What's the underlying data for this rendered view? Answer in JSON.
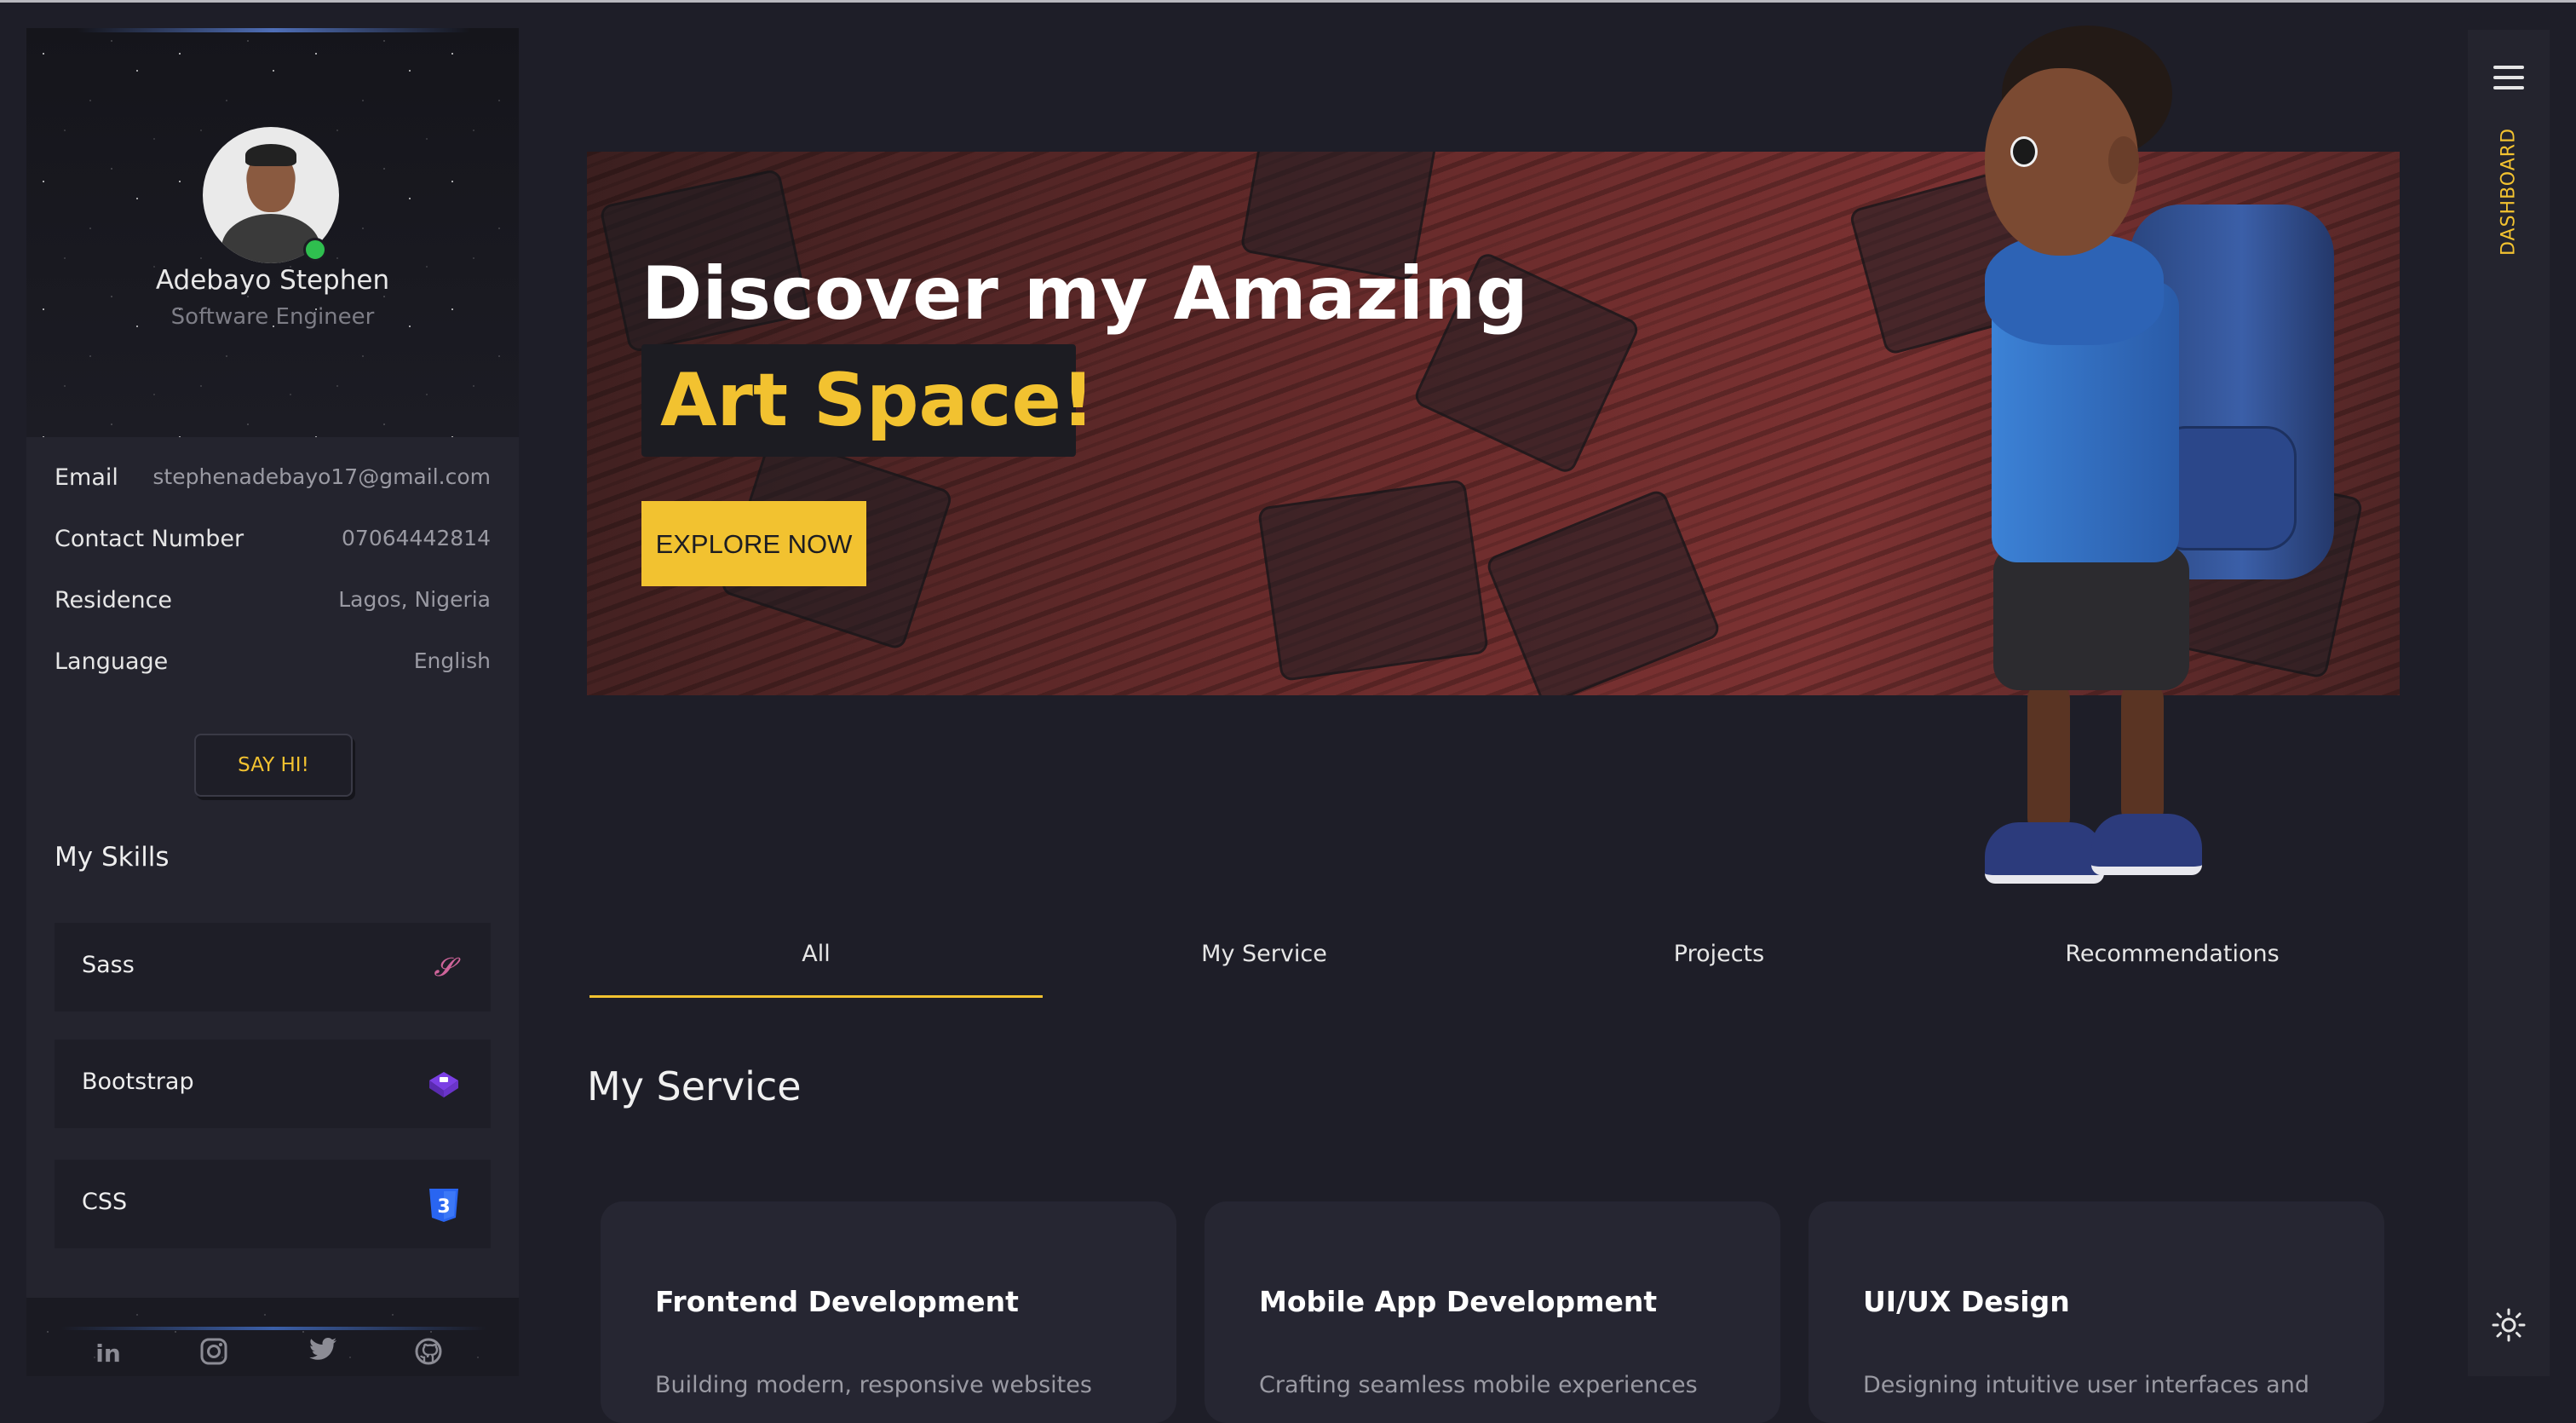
{
  "profile": {
    "name": "Adebayo Stephen",
    "role": "Software Engineer"
  },
  "info": [
    {
      "label": "Email",
      "value": "stephenadebayo17@gmail.com"
    },
    {
      "label": "Contact Number",
      "value": "07064442814"
    },
    {
      "label": "Residence",
      "value": "Lagos, Nigeria"
    },
    {
      "label": "Language",
      "value": "English"
    }
  ],
  "say_hi_label": "SAY HI!",
  "skills": {
    "title": "My Skills",
    "items": [
      {
        "label": "Sass",
        "icon": "sass-icon"
      },
      {
        "label": "Bootstrap",
        "icon": "bootstrap-icon"
      },
      {
        "label": "CSS",
        "icon": "css3-icon"
      }
    ]
  },
  "social": [
    {
      "icon": "linkedin-icon",
      "glyph": "in"
    },
    {
      "icon": "instagram-icon",
      "glyph": "◎"
    },
    {
      "icon": "twitter-icon",
      "glyph": "🐦"
    },
    {
      "icon": "github-icon",
      "glyph": "⊙"
    }
  ],
  "hero": {
    "title_line1": "Discover my Amazing",
    "title_line2": "Art Space!",
    "cta_label": "EXPLORE NOW"
  },
  "tabs": [
    {
      "label": "All",
      "active": true
    },
    {
      "label": "My Service",
      "active": false
    },
    {
      "label": "Projects",
      "active": false
    },
    {
      "label": "Recommendations",
      "active": false
    }
  ],
  "services": {
    "title": "My Service",
    "cards": [
      {
        "title": "Frontend Development",
        "desc": "Building modern, responsive websites"
      },
      {
        "title": "Mobile App Development",
        "desc": "Crafting seamless mobile experiences"
      },
      {
        "title": "UI/UX Design",
        "desc": "Designing intuitive user interfaces and"
      }
    ]
  },
  "rail": {
    "label": "DASHBOARD",
    "menu_icon": "hamburger-menu-icon",
    "theme_icon": "sun-icon"
  },
  "colors": {
    "accent": "#f2c230",
    "background": "#1e1e28",
    "panel": "#24242e",
    "online": "#2fbf4f"
  }
}
